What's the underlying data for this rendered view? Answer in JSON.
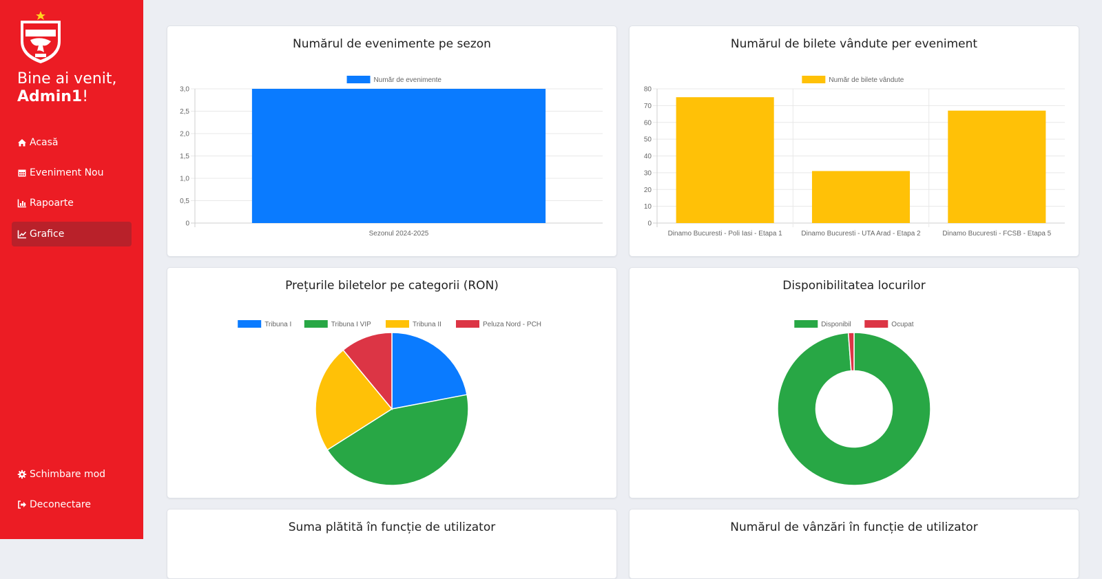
{
  "sidebar": {
    "logo_icon": "dinamo-crest-icon",
    "welcome_prefix": "Bine ai venit,",
    "username": "Admin1",
    "welcome_suffix": "!",
    "accent_color": "#ec1c24",
    "active_color": "#b9212a",
    "nav": [
      {
        "label": "Acasă",
        "icon": "home-icon"
      },
      {
        "label": "Eveniment Nou",
        "icon": "calendar-icon"
      },
      {
        "label": "Rapoarte",
        "icon": "bar-chart-icon"
      },
      {
        "label": "Grafice",
        "icon": "line-chart-icon",
        "active": true
      }
    ],
    "bottom_nav": [
      {
        "label": "Schimbare mod",
        "icon": "gear-icon"
      },
      {
        "label": "Deconectare",
        "icon": "sign-out-icon"
      }
    ]
  },
  "cards": {
    "events_title": "Numărul de evenimente pe sezon",
    "tickets_title": "Numărul de bilete vândute per eveniment",
    "prices_title": "Prețurile biletelor pe categorii (RON)",
    "seats_title": "Disponibilitatea locurilor",
    "paid_title": "Suma plătită în funcție de utilizator",
    "sales_title": "Numărul de vânzări în funcție de utilizator"
  },
  "chart_data": [
    {
      "type": "bar",
      "title": "Numărul de evenimente pe sezon",
      "categories": [
        "Sezonul 2024-2025"
      ],
      "series": [
        {
          "name": "Număr de evenimente",
          "values": [
            3
          ],
          "color": "#0a7bff"
        }
      ],
      "ylim": [
        0,
        3
      ],
      "yticks": [
        "0",
        "0,5",
        "1,0",
        "1,5",
        "2,0",
        "2,5",
        "3,0"
      ],
      "grid": true,
      "legend": "top"
    },
    {
      "type": "bar",
      "title": "Numărul de bilete vândute per eveniment",
      "categories": [
        "Dinamo Bucuresti - Poli Iasi - Etapa 1",
        "Dinamo Bucuresti - UTA Arad - Etapa 2",
        "Dinamo Bucuresti - FCSB - Etapa 5"
      ],
      "series": [
        {
          "name": "Număr de bilete vândute",
          "values": [
            75,
            31,
            67
          ],
          "color": "#ffc107"
        }
      ],
      "ylim": [
        0,
        80
      ],
      "yticks": [
        "0",
        "10",
        "20",
        "30",
        "40",
        "50",
        "60",
        "70",
        "80"
      ],
      "grid": true,
      "legend": "top"
    },
    {
      "type": "pie",
      "title": "Prețurile biletelor pe categorii (RON)",
      "labels": [
        "Tribuna I",
        "Tribuna I VIP",
        "Tribuna II",
        "Peluza Nord - PCH"
      ],
      "values": [
        22,
        44,
        23,
        11
      ],
      "colors": [
        "#0a7bff",
        "#28a745",
        "#ffc107",
        "#dc3545"
      ],
      "legend": "top"
    },
    {
      "type": "pie",
      "title": "Disponibilitatea locurilor",
      "labels": [
        "Disponibil",
        "Ocupat"
      ],
      "values": [
        98.8,
        1.2
      ],
      "colors": [
        "#28a745",
        "#dc3545"
      ],
      "donut": true,
      "legend": "top"
    }
  ]
}
